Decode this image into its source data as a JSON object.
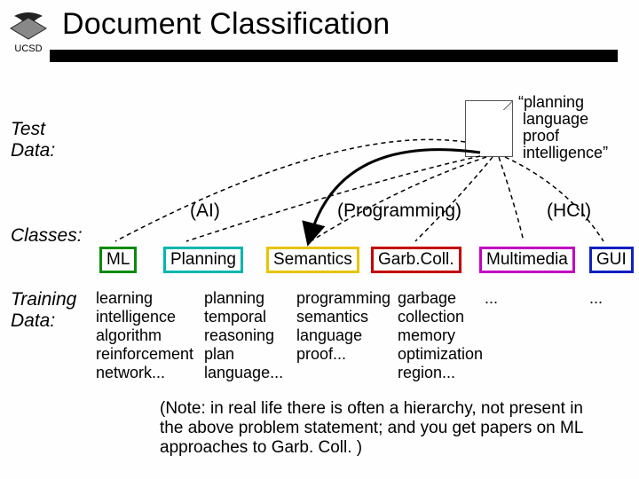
{
  "title": "Document Classification",
  "org": "UCSD",
  "labels": {
    "test_data": "Test\nData:",
    "classes": "Classes:",
    "training_data": "Training\nData:"
  },
  "test_quote": "“planning\n language\n proof\n intelligence”",
  "groups": {
    "ai": "(AI)",
    "programming": "(Programming)",
    "hci": "(HCI)"
  },
  "classes": [
    {
      "name": "ML"
    },
    {
      "name": "Planning"
    },
    {
      "name": "Semantics"
    },
    {
      "name": "Garb.Coll."
    },
    {
      "name": "Multimedia"
    },
    {
      "name": "GUI"
    }
  ],
  "training": {
    "ml": "learning\nintelligence\nalgorithm\nreinforcement\nnetwork...",
    "plan": "planning\ntemporal\nreasoning\nplan\nlanguage...",
    "sem": "programming\nsemantics\nlanguage\nproof...",
    "garb": "garbage\ncollection\nmemory\noptimization\nregion...",
    "multi": "...",
    "gui": "..."
  },
  "footnote": "(Note: in real life there is often a hierarchy, not present in the above problem statement; and you get papers on ML approaches to Garb. Coll. )"
}
